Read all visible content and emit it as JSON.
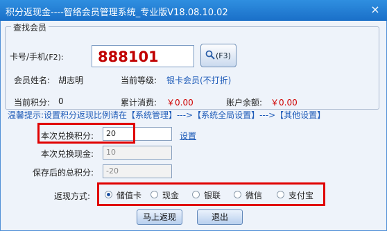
{
  "window": {
    "title": "积分返现金----智络会员管理系统_专业版V18.08.10.02",
    "close_glyph": "×"
  },
  "search_group": {
    "title": "查找会员",
    "card_label": "卡号/手机",
    "card_hint": "(F2):",
    "card_value": "888101",
    "search_button_label": "(F3)",
    "name_label": "会员姓名:",
    "name_value": "胡志明",
    "level_label": "当前等级:",
    "level_value": "银卡会员(不打折)",
    "points_label": "当前积分:",
    "points_value": "0",
    "consume_label": "累计消费:",
    "consume_value": "￥0.00",
    "balance_label": "账户余额:",
    "balance_value": "￥0.00"
  },
  "tip": "温馨提示:设置积分返现比例请在【系统管理】--->【系统全局设置】--->【其他设置】",
  "form": {
    "points_label": "本次兑换积分:",
    "points_value": "20",
    "settings_link": "设置",
    "cash_label": "本次兑换现金:",
    "cash_value": "10",
    "remaining_label": "保存后的总积分:",
    "remaining_value": "-20"
  },
  "payment": {
    "label": "返现方式:",
    "options": [
      "储值卡",
      "现金",
      "银联",
      "微信",
      "支付宝"
    ],
    "selected": "储值卡"
  },
  "buttons": {
    "confirm": "马上返现",
    "exit": "退出"
  },
  "colors": {
    "title_bar": "#1a6fc8",
    "highlight_border": "#e00000",
    "accent_text": "#1e5bb8",
    "money_red": "#d00000"
  }
}
